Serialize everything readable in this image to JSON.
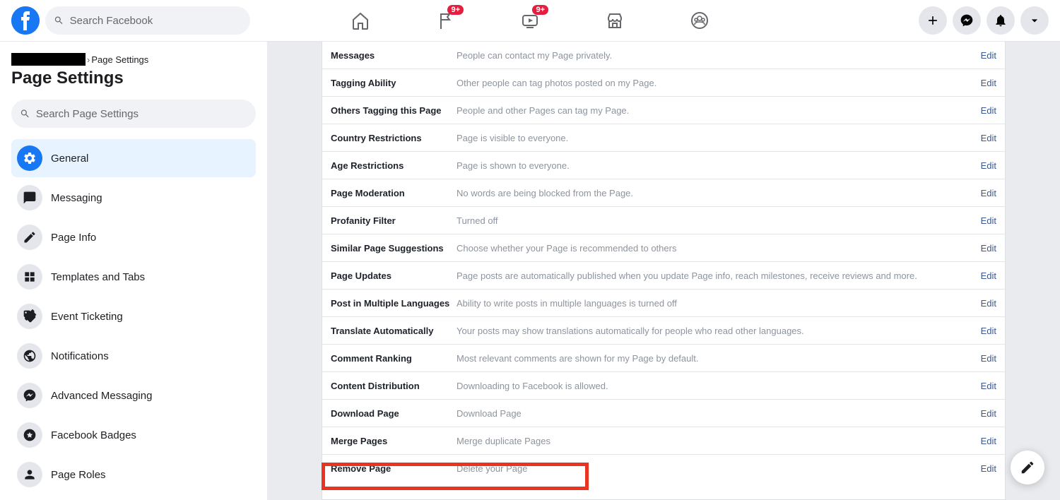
{
  "header": {
    "search_placeholder": "Search Facebook",
    "badges": {
      "pages": "9+",
      "watch": "9+"
    }
  },
  "sidebar": {
    "breadcrumb_current": "Page Settings",
    "title": "Page Settings",
    "search_placeholder": "Search Page Settings",
    "items": [
      {
        "label": "General"
      },
      {
        "label": "Messaging"
      },
      {
        "label": "Page Info"
      },
      {
        "label": "Templates and Tabs"
      },
      {
        "label": "Event Ticketing"
      },
      {
        "label": "Notifications"
      },
      {
        "label": "Advanced Messaging"
      },
      {
        "label": "Facebook Badges"
      },
      {
        "label": "Page Roles"
      }
    ]
  },
  "settings": {
    "edit_label": "Edit",
    "rows": [
      {
        "label": "Messages",
        "value": "People can contact my Page privately."
      },
      {
        "label": "Tagging Ability",
        "value": "Other people can tag photos posted on my Page."
      },
      {
        "label": "Others Tagging this Page",
        "value": "People and other Pages can tag my Page."
      },
      {
        "label": "Country Restrictions",
        "value": "Page is visible to everyone."
      },
      {
        "label": "Age Restrictions",
        "value": "Page is shown to everyone."
      },
      {
        "label": "Page Moderation",
        "value": "No words are being blocked from the Page."
      },
      {
        "label": "Profanity Filter",
        "value": "Turned off"
      },
      {
        "label": "Similar Page Suggestions",
        "value": "Choose whether your Page is recommended to others"
      },
      {
        "label": "Page Updates",
        "value": "Page posts are automatically published when you update Page info, reach milestones, receive reviews and more."
      },
      {
        "label": "Post in Multiple Languages",
        "value": "Ability to write posts in multiple languages is turned off"
      },
      {
        "label": "Translate Automatically",
        "value": "Your posts may show translations automatically for people who read other languages."
      },
      {
        "label": "Comment Ranking",
        "value": "Most relevant comments are shown for my Page by default."
      },
      {
        "label": "Content Distribution",
        "value": "Downloading to Facebook is allowed."
      },
      {
        "label": "Download Page",
        "value": "Download Page"
      },
      {
        "label": "Merge Pages",
        "value": "Merge duplicate Pages"
      },
      {
        "label": "Remove Page",
        "value": "Delete your Page"
      }
    ]
  }
}
